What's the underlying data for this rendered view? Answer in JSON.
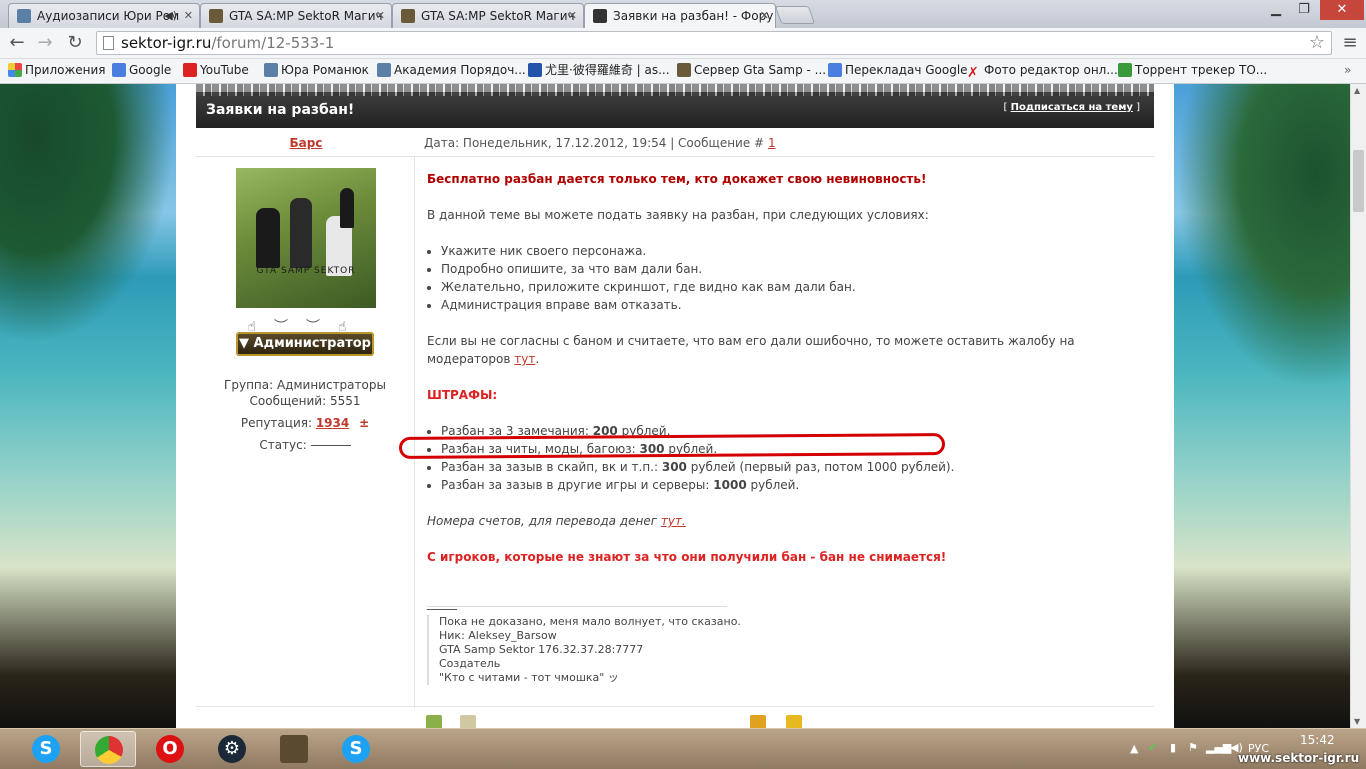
{
  "tabs": [
    {
      "label": "Аудиозаписи Юри Ром"
    },
    {
      "label": "GTA SA:MP SektoR Магич"
    },
    {
      "label": "GTA SA:MP SektoR Магич"
    },
    {
      "label": "Заявки на разбан! - Фору"
    }
  ],
  "url": {
    "host": "sektor-igr.ru",
    "path": "/forum/12-533-1"
  },
  "bookmarks": [
    "Приложения",
    "Google",
    "YouTube",
    "Юра Романюк",
    "Академия Порядоч...",
    "尤里·彼得羅維奇 | as...",
    "Сервер Gta Samp - ...",
    "Перекладач Google",
    "Фото редактор онл...",
    "Торрент трекер ТО..."
  ],
  "topic": {
    "title": "Заявки на разбан!",
    "subscribe": "Подписаться на тему"
  },
  "post": {
    "author": "Барс",
    "meta_prefix": "Дата: Понедельник, 17.12.2012, 19:54 | Сообщение #",
    "message_num": "1",
    "avatar_caption": "GTA SAMP SEKTOR",
    "badge": "Администратор",
    "group": "Группа: Администраторы",
    "messages": "Сообщений: 5551",
    "reputation_label": "Репутация:",
    "reputation_value": "1934",
    "reputation_pm": "±",
    "status_label": "Статус:",
    "body": {
      "headline": "Бесплатно разбан дается только тем, кто докажет свою невиновность!",
      "intro": "В данной теме вы можете подать заявку на разбан, при следующих условиях:",
      "conditions": [
        "Укажите ник своего персонажа.",
        "Подробно опишите, за что вам дали бан.",
        "Желательно, приложите скриншот, где видно как вам дали бан.",
        "Администрация вправе вам отказать."
      ],
      "complaint_text": "Если вы не согласны с баном и считаете, что вам его дали ошибочно, то можете оставить жалобу на модераторов",
      "link_tut": "тут",
      "fines_title": "ШТРАФЫ:",
      "fines": [
        {
          "prefix": "Разбан за 3 замечания:",
          "amount": "200",
          "suffix": "рублей."
        },
        {
          "prefix": "Разбан за читы, моды, багоюз:",
          "amount": "300",
          "suffix": "рублей."
        },
        {
          "prefix": "Разбан за зазыв в скайп, вк и т.п.:",
          "amount": "300",
          "suffix": "рублей (первый раз, потом 1000 рублей)."
        },
        {
          "prefix": "Разбан за зазыв в другие игры и серверы:",
          "amount": "1000",
          "suffix": "рублей."
        }
      ],
      "accounts_text": "Номера счетов, для перевода денег",
      "accounts_link": "тут.",
      "warning": "С игроков, которые не знают за что они получили бан - бан не снимается!",
      "dash": "_____"
    },
    "signature": [
      "Пока не доказано, меня мало волнует, что сказано.",
      "Ник: Aleksey_Barsow",
      "GTA Samp Sektor 176.32.37.28:7777",
      "Создатель",
      "\"Кто с читами - тот чмошка\" ッ"
    ]
  },
  "taskbar": {
    "lang": "РУС",
    "time": "15:42",
    "watermark": "www.sektor-igr.ru"
  },
  "colors": {
    "accent_red": "#c0392b",
    "title_dark_red": "#b00000",
    "highlight_ring": "#d40000"
  }
}
